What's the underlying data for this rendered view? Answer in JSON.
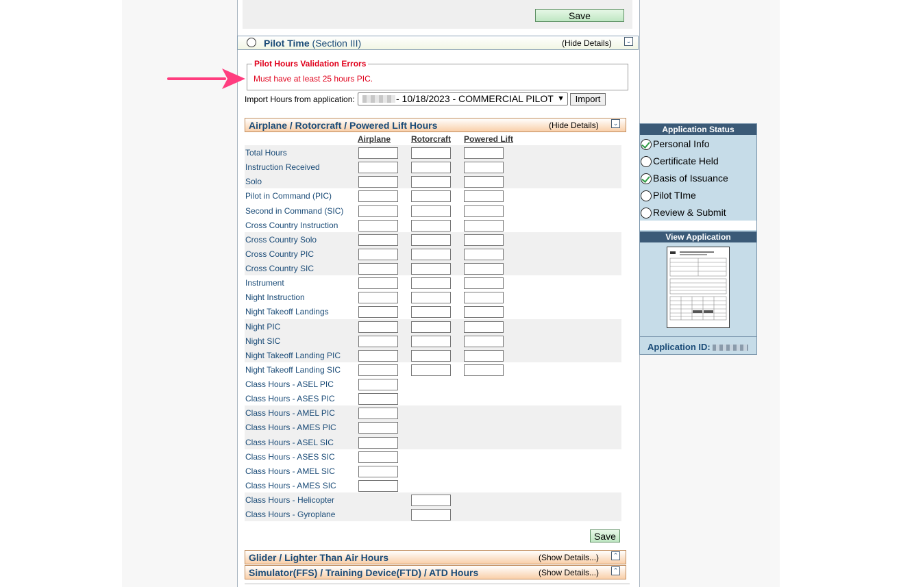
{
  "top": {
    "save_label": "Save"
  },
  "section": {
    "title": "Pilot Time",
    "subtitle": "(Section III)",
    "hide_details": "(Hide Details)"
  },
  "validation": {
    "legend": "Pilot Hours Validation Errors",
    "message": "Must have at least 25 hours PIC."
  },
  "import": {
    "label": "Import Hours from application:",
    "selected": " - 10/18/2023 - COMMERCIAL PILOT",
    "button": "Import"
  },
  "hours": {
    "title": "Airplane / Rotorcraft / Powered Lift Hours",
    "hide_details": "(Hide Details)",
    "columns": [
      "Airplane",
      "Rotorcraft",
      "Powered Lift"
    ],
    "rows": [
      {
        "label": "Total Hours"
      },
      {
        "label": "Instruction Received"
      },
      {
        "label": "Solo"
      },
      {
        "label": "Pilot in Command (PIC)"
      },
      {
        "label": "Second in Command (SIC)"
      },
      {
        "label": "Cross Country Instruction"
      },
      {
        "label": "Cross Country Solo"
      },
      {
        "label": "Cross Country PIC"
      },
      {
        "label": "Cross Country SIC"
      },
      {
        "label": "Instrument"
      },
      {
        "label": "Night Instruction"
      },
      {
        "label": "Night Takeoff Landings"
      },
      {
        "label": "Night PIC"
      },
      {
        "label": "Night SIC"
      },
      {
        "label": "Night Takeoff Landing PIC"
      },
      {
        "label": "Night Takeoff Landing SIC"
      },
      {
        "label": "Class Hours - ASEL PIC"
      },
      {
        "label": "Class Hours - ASES PIC"
      },
      {
        "label": "Class Hours - AMEL PIC"
      },
      {
        "label": "Class Hours - AMES PIC"
      },
      {
        "label": "Class Hours - ASEL SIC"
      },
      {
        "label": "Class Hours - ASES SIC"
      },
      {
        "label": "Class Hours - AMEL SIC"
      },
      {
        "label": "Class Hours - AMES SIC"
      },
      {
        "label": "Class Hours - Helicopter"
      },
      {
        "label": "Class Hours - Gyroplane"
      }
    ],
    "save_label": "Save"
  },
  "glider": {
    "title": "Glider / Lighter Than Air Hours",
    "show_details": "(Show Details...)"
  },
  "simulator": {
    "title": "Simulator(FFS) / Training Device(FTD) / ATD Hours",
    "show_details": "(Show Details...)"
  },
  "sidebar": {
    "status_title": "Application Status",
    "items": [
      {
        "label": "Personal Info",
        "done": true
      },
      {
        "label": "Certificate Held",
        "done": false
      },
      {
        "label": "Basis of Issuance",
        "done": true
      },
      {
        "label": "Pilot TIme",
        "done": false
      },
      {
        "label": "Review & Submit",
        "done": false
      }
    ],
    "view_title": "View Application",
    "app_id_label": "Application ID:"
  },
  "colors": {
    "accent": "#1a4b77",
    "error": "#e0001b",
    "sidebar_bg": "#c6dce8",
    "header_bg": "#3b5a77"
  },
  "icons": [
    "radio-icon",
    "collapse-icon",
    "expand-icon",
    "check-icon",
    "arrow-icon"
  ]
}
